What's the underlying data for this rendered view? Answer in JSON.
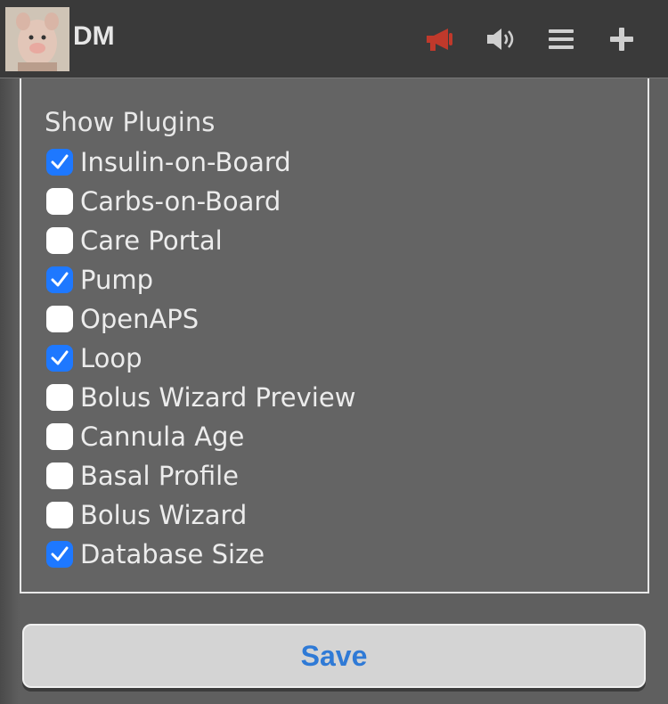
{
  "header": {
    "user_name": "DM",
    "icons": {
      "announcement": "megaphone-icon",
      "sound": "speaker-icon",
      "menu": "hamburger-menu-icon",
      "add": "plus-icon"
    }
  },
  "panel": {
    "title": "Show Plugins",
    "plugins": [
      {
        "label": "Insulin-on-Board",
        "checked": true
      },
      {
        "label": "Carbs-on-Board",
        "checked": false
      },
      {
        "label": "Care Portal",
        "checked": false
      },
      {
        "label": "Pump",
        "checked": true
      },
      {
        "label": "OpenAPS",
        "checked": false
      },
      {
        "label": "Loop",
        "checked": true
      },
      {
        "label": "Bolus Wizard Preview",
        "checked": false
      },
      {
        "label": "Cannula Age",
        "checked": false
      },
      {
        "label": "Basal Profile",
        "checked": false
      },
      {
        "label": "Bolus Wizard",
        "checked": false
      },
      {
        "label": "Database Size",
        "checked": true
      }
    ]
  },
  "save_label": "Save",
  "colors": {
    "checkbox_checked": "#1e78ff",
    "announcement_icon": "#c0392b",
    "save_text": "#2f7ad6"
  }
}
